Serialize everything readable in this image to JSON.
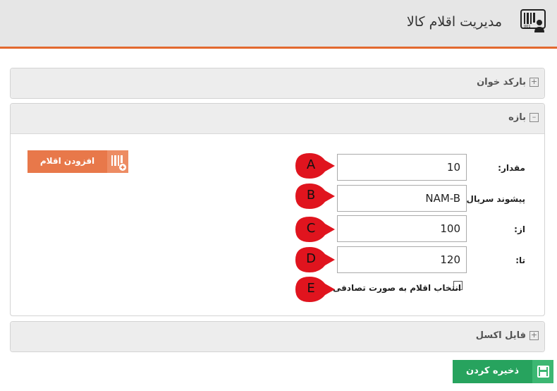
{
  "header": {
    "title": "مدیریت اقلام کالا",
    "icon": "barcode-user-icon"
  },
  "colors": {
    "accent": "#e2692f",
    "add_button": "#e8784a",
    "save_button": "#27a35e",
    "marker": "#e0141e"
  },
  "panels": {
    "barcode": {
      "toggle": "+",
      "title": "بارکد خوان"
    },
    "range": {
      "toggle": "–",
      "title": "بازه"
    },
    "excel": {
      "toggle": "+",
      "title": "فایل اکسل"
    }
  },
  "form": {
    "quantity": {
      "label": "مقدار:",
      "value": "10",
      "marker": "A"
    },
    "serial_prefix": {
      "label": "پیشوند سریال :",
      "value": "NAM-B",
      "marker": "B"
    },
    "from": {
      "label": "از:",
      "value": "100",
      "marker": "C"
    },
    "to": {
      "label": "تا:",
      "value": "120",
      "marker": "D"
    },
    "random": {
      "label": "انتخاب اقلام به صورت تصادفی",
      "checked": false,
      "marker": "E"
    }
  },
  "buttons": {
    "add_items": "افزودن اقلام",
    "save": "ذخیره کردن"
  }
}
